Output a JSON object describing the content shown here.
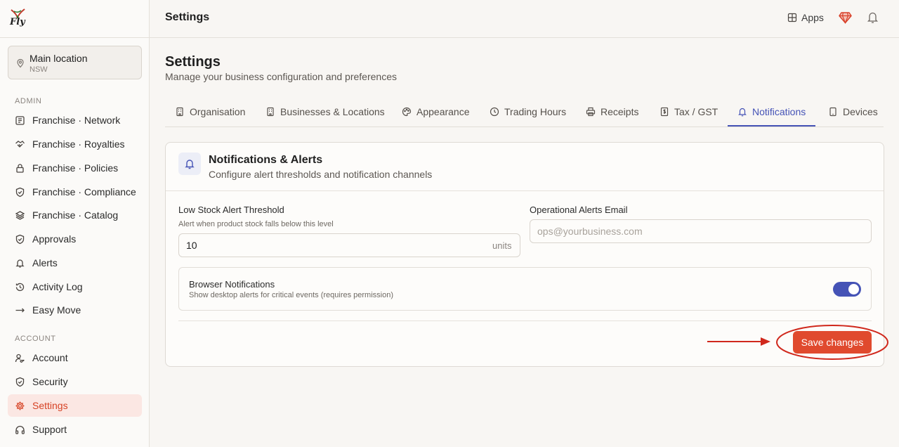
{
  "brand": {
    "logo_text": "Fly"
  },
  "location": {
    "name": "Main location",
    "region": "NSW"
  },
  "sidebar": {
    "admin_label": "ADMIN",
    "admin_items": [
      {
        "label": "Franchise · Network",
        "icon": "network-icon"
      },
      {
        "label": "Franchise · Royalties",
        "icon": "handshake-icon"
      },
      {
        "label": "Franchise · Policies",
        "icon": "lock-icon"
      },
      {
        "label": "Franchise · Compliance",
        "icon": "shield-icon"
      },
      {
        "label": "Franchise · Catalog",
        "icon": "layers-icon"
      },
      {
        "label": "Approvals",
        "icon": "shield-check-icon"
      },
      {
        "label": "Alerts",
        "icon": "bell-icon"
      },
      {
        "label": "Activity Log",
        "icon": "history-icon"
      },
      {
        "label": "Easy Move",
        "icon": "arrow-right-icon"
      }
    ],
    "account_label": "ACCOUNT",
    "account_items": [
      {
        "label": "Account",
        "icon": "user-key-icon"
      },
      {
        "label": "Security",
        "icon": "shield-icon"
      },
      {
        "label": "Settings",
        "icon": "gear-icon",
        "active": true
      },
      {
        "label": "Support",
        "icon": "headphones-icon"
      }
    ]
  },
  "topbar": {
    "title": "Settings",
    "apps_label": "Apps"
  },
  "page": {
    "title": "Settings",
    "subtitle": "Manage your business configuration and preferences"
  },
  "tabs": [
    {
      "label": "Organisation",
      "icon": "building-icon"
    },
    {
      "label": "Businesses & Locations",
      "icon": "building-icon"
    },
    {
      "label": "Appearance",
      "icon": "palette-icon"
    },
    {
      "label": "Trading Hours",
      "icon": "clock-icon"
    },
    {
      "label": "Receipts",
      "icon": "printer-icon"
    },
    {
      "label": "Tax / GST",
      "icon": "receipt-dollar-icon"
    },
    {
      "label": "Notifications",
      "icon": "bell-icon",
      "active": true
    },
    {
      "label": "Devices",
      "icon": "tablet-icon"
    }
  ],
  "card": {
    "title": "Notifications & Alerts",
    "subtitle": "Configure alert thresholds and notification channels",
    "low_stock": {
      "label": "Low Stock Alert Threshold",
      "help": "Alert when product stock falls below this level",
      "value": "10",
      "units": "units"
    },
    "ops_email": {
      "label": "Operational Alerts Email",
      "value": "",
      "placeholder": "ops@yourbusiness.com"
    },
    "browser": {
      "title": "Browser Notifications",
      "subtitle": "Show desktop alerts for critical events (requires permission)",
      "enabled": true
    },
    "save_label": "Save changes"
  },
  "colors": {
    "accent": "#4553b6",
    "brand": "#e04a2e",
    "annotation": "#d0281c",
    "active_bg": "#fbe7e3"
  }
}
